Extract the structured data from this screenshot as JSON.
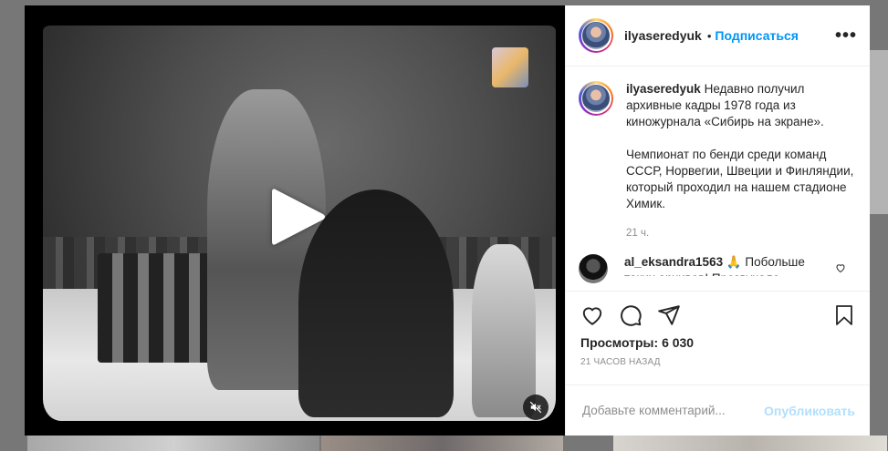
{
  "post": {
    "username": "ilyaseredyuk",
    "follow_label": "Подписаться",
    "separator": "•",
    "more_label": "•••"
  },
  "caption": {
    "username": "ilyaseredyuk",
    "paragraph1": "Недавно получил архивные кадры 1978 года из киножурнала «Сибирь на экране».",
    "paragraph2": "Чемпионат по бенди среди команд СССР, Норвегии, Швеции и Финляндии, который проходил на нашем стадионе Химик.",
    "time": "21 ч."
  },
  "comments": [
    {
      "username": "al_eksandra1563",
      "text": "🙏 Побольше таких архивов! Прозвучало"
    }
  ],
  "stats": {
    "views_label": "Просмотры:",
    "views_count": "6 030",
    "posted_ago": "21 ЧАСОВ НАЗАД"
  },
  "comment_box": {
    "placeholder": "Добавьте комментарий...",
    "publish_label": "Опубликовать"
  },
  "icons": {
    "play": "play-icon",
    "mute": "muted-speaker-icon",
    "like": "heart-icon",
    "comment": "comment-bubble-icon",
    "share": "paper-plane-icon",
    "save": "bookmark-icon",
    "comment_like": "heart-icon"
  },
  "colors": {
    "accent": "#0095f6",
    "publish_disabled": "#b2dffc",
    "text": "#262626",
    "muted_text": "#8e8e8e"
  }
}
